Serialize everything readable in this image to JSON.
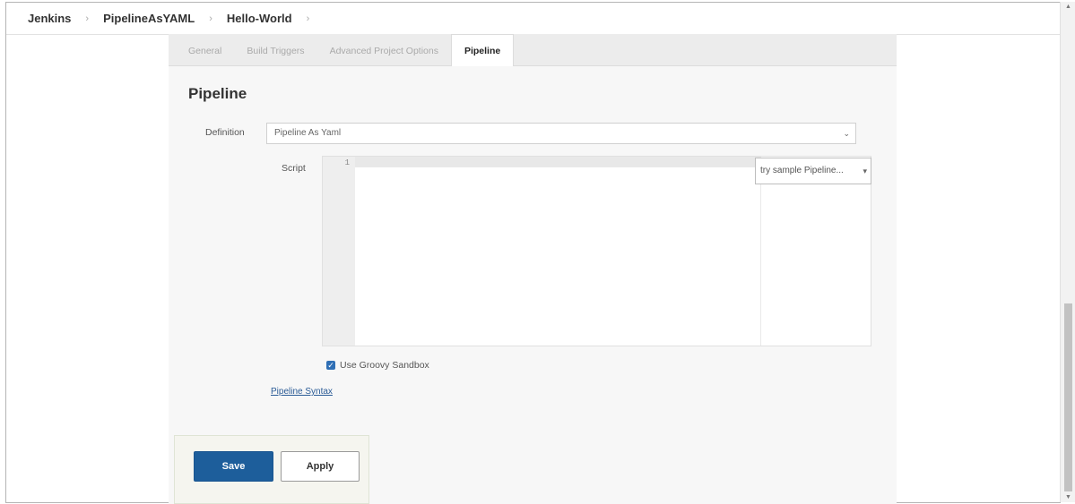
{
  "breadcrumb": {
    "items": [
      "Jenkins",
      "PipelineAsYAML",
      "Hello-World"
    ],
    "separator": "›"
  },
  "tabs": [
    {
      "label": "General",
      "active": false
    },
    {
      "label": "Build Triggers",
      "active": false
    },
    {
      "label": "Advanced Project Options",
      "active": false
    },
    {
      "label": "Pipeline",
      "active": true
    }
  ],
  "pipeline": {
    "section_title": "Pipeline",
    "definition_label": "Definition",
    "definition_value": "Pipeline As Yaml",
    "script_label": "Script",
    "editor_line_number": "1",
    "sample_select_value": "try sample Pipeline...",
    "use_groovy_sandbox_label": "Use Groovy Sandbox",
    "use_groovy_sandbox_checked": true,
    "pipeline_syntax_link": "Pipeline Syntax"
  },
  "buttons": {
    "save_label": "Save",
    "apply_label": "Apply"
  },
  "colors": {
    "save_button": "#1d5e9b",
    "link": "#2a5b96",
    "checkbox": "#2f6fb5"
  }
}
